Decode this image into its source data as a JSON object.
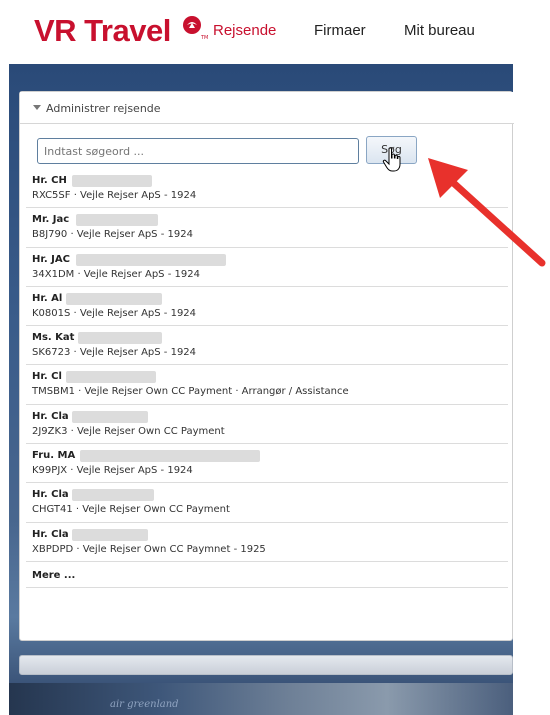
{
  "header": {
    "logo_text": "VR Travel",
    "nav": [
      {
        "label": "Rejsende",
        "active": true
      },
      {
        "label": "Firmaer",
        "active": false
      },
      {
        "label": "Mit bureau",
        "active": false
      }
    ],
    "brand_color": "#c8102e"
  },
  "panel": {
    "title": "Administrer rejsende",
    "search": {
      "placeholder": "Indtast søgeord ...",
      "value": ""
    },
    "search_button": "Søg",
    "results": [
      {
        "name": "Hr. CH",
        "detail": "RXC5SF · Vejle Rejser ApS - 1924"
      },
      {
        "name": "Mr. Jac",
        "detail": "B8J790 · Vejle Rejser ApS - 1924"
      },
      {
        "name": "Hr. JAC",
        "detail": "34X1DM · Vejle Rejser ApS - 1924"
      },
      {
        "name": "Hr. Al",
        "detail": "K0801S · Vejle Rejser ApS - 1924"
      },
      {
        "name": "Ms. Kat",
        "detail": "SK6723 · Vejle Rejser ApS - 1924"
      },
      {
        "name": "Hr. Cl",
        "detail": "TMSBM1 · Vejle Rejser Own CC Payment · Arrangør / Assistance"
      },
      {
        "name": "Hr. Cla",
        "detail": "2J9ZK3 · Vejle Rejser Own CC Payment"
      },
      {
        "name": "Fru. MA",
        "detail": "K99PJX · Vejle Rejser ApS - 1924"
      },
      {
        "name": "Hr. Cla",
        "detail": "CHGT41 · Vejle Rejser Own CC Payment"
      },
      {
        "name": "Hr. Cla",
        "detail": "XBPDPD · Vejle Rejser Own CC Paymnet - 1925"
      }
    ],
    "more_label": "Mere ..."
  },
  "footer": {
    "text": "air greenland"
  },
  "annotation_color": "#e8312c"
}
